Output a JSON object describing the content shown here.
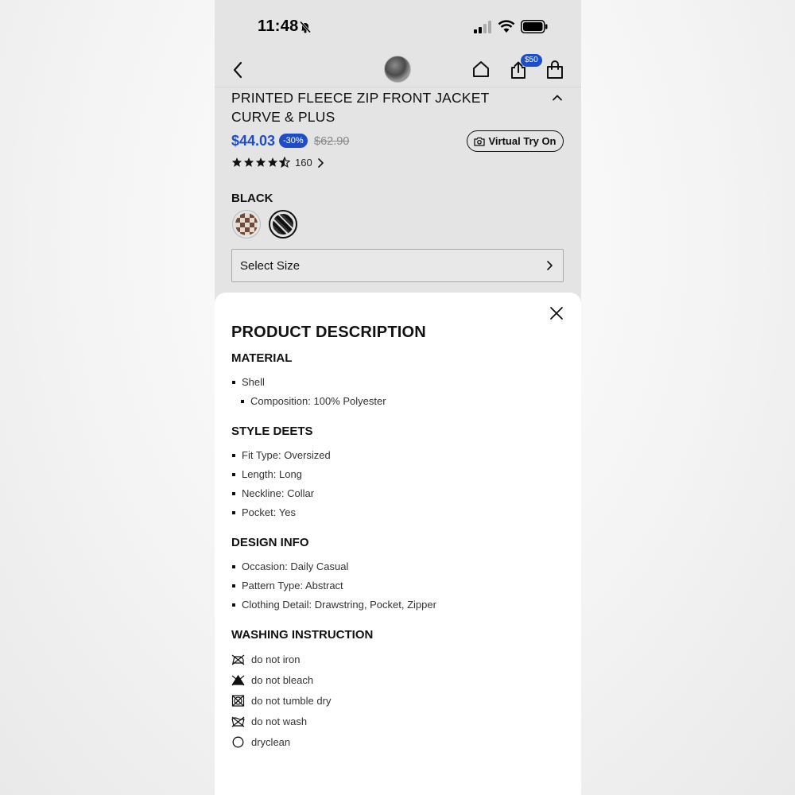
{
  "status_bar": {
    "time": "11:48"
  },
  "nav": {
    "share_badge": "$50"
  },
  "product": {
    "title": "PRINTED FLEECE ZIP FRONT JACKET CURVE & PLUS",
    "price": "$44.03",
    "discount": "-30%",
    "original_price": "$62.90",
    "virtual_try_on": "Virtual Try On",
    "rating_stars": 4.5,
    "review_count": "160",
    "color_label": "BLACK",
    "swatches": [
      "brown",
      "black"
    ],
    "size_placeholder": "Select Size"
  },
  "description": {
    "heading": "PRODUCT DESCRIPTION",
    "material": {
      "heading": "MATERIAL",
      "shell": "Shell",
      "composition": "Composition: 100% Polyester"
    },
    "style": {
      "heading": "STYLE DEETS",
      "items": [
        "Fit Type: Oversized",
        "Length: Long",
        "Neckline: Collar",
        "Pocket: Yes"
      ]
    },
    "design": {
      "heading": "DESIGN INFO",
      "items": [
        "Occasion: Daily Casual",
        "Pattern Type: Abstract",
        "Clothing Detail: Drawstring, Pocket, Zipper"
      ]
    },
    "washing": {
      "heading": "WASHING INSTRUCTION",
      "items": [
        {
          "icon": "no-iron-icon",
          "label": "do not iron"
        },
        {
          "icon": "no-bleach-icon",
          "label": "do not bleach"
        },
        {
          "icon": "no-tumble-dry-icon",
          "label": "do not tumble dry"
        },
        {
          "icon": "no-wash-icon",
          "label": "do not wash"
        },
        {
          "icon": "dryclean-icon",
          "label": "dryclean"
        }
      ]
    }
  },
  "colors": {
    "accent": "#1d4ec8",
    "text": "#111111",
    "sheet": "#ffffff",
    "page_bg": "#e4e4e4"
  }
}
